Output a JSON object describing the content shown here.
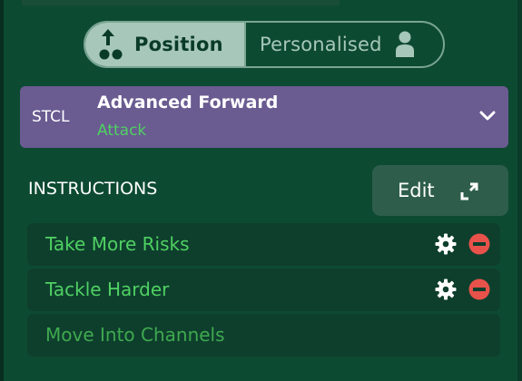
{
  "toggle": {
    "position_label": "Position",
    "personalised_label": "Personalised"
  },
  "role": {
    "code": "STCL",
    "name": "Advanced Forward",
    "duty": "Attack"
  },
  "instructions": {
    "heading": "INSTRUCTIONS",
    "edit_label": "Edit",
    "items": [
      {
        "label": "Take More Risks"
      },
      {
        "label": "Tackle Harder"
      },
      {
        "label": "Move Into Channels"
      }
    ]
  },
  "colors": {
    "background": "#0d4a32",
    "role_bar": "#6a5b91",
    "accent_green": "#4fd162",
    "remove_red": "#e8524a"
  },
  "icons": {
    "position": "tactics-position-icon",
    "personalised": "person-icon",
    "chevron": "chevron-down-icon",
    "edit": "expand-icon",
    "gear": "gear-icon",
    "remove": "remove-circle-icon"
  }
}
